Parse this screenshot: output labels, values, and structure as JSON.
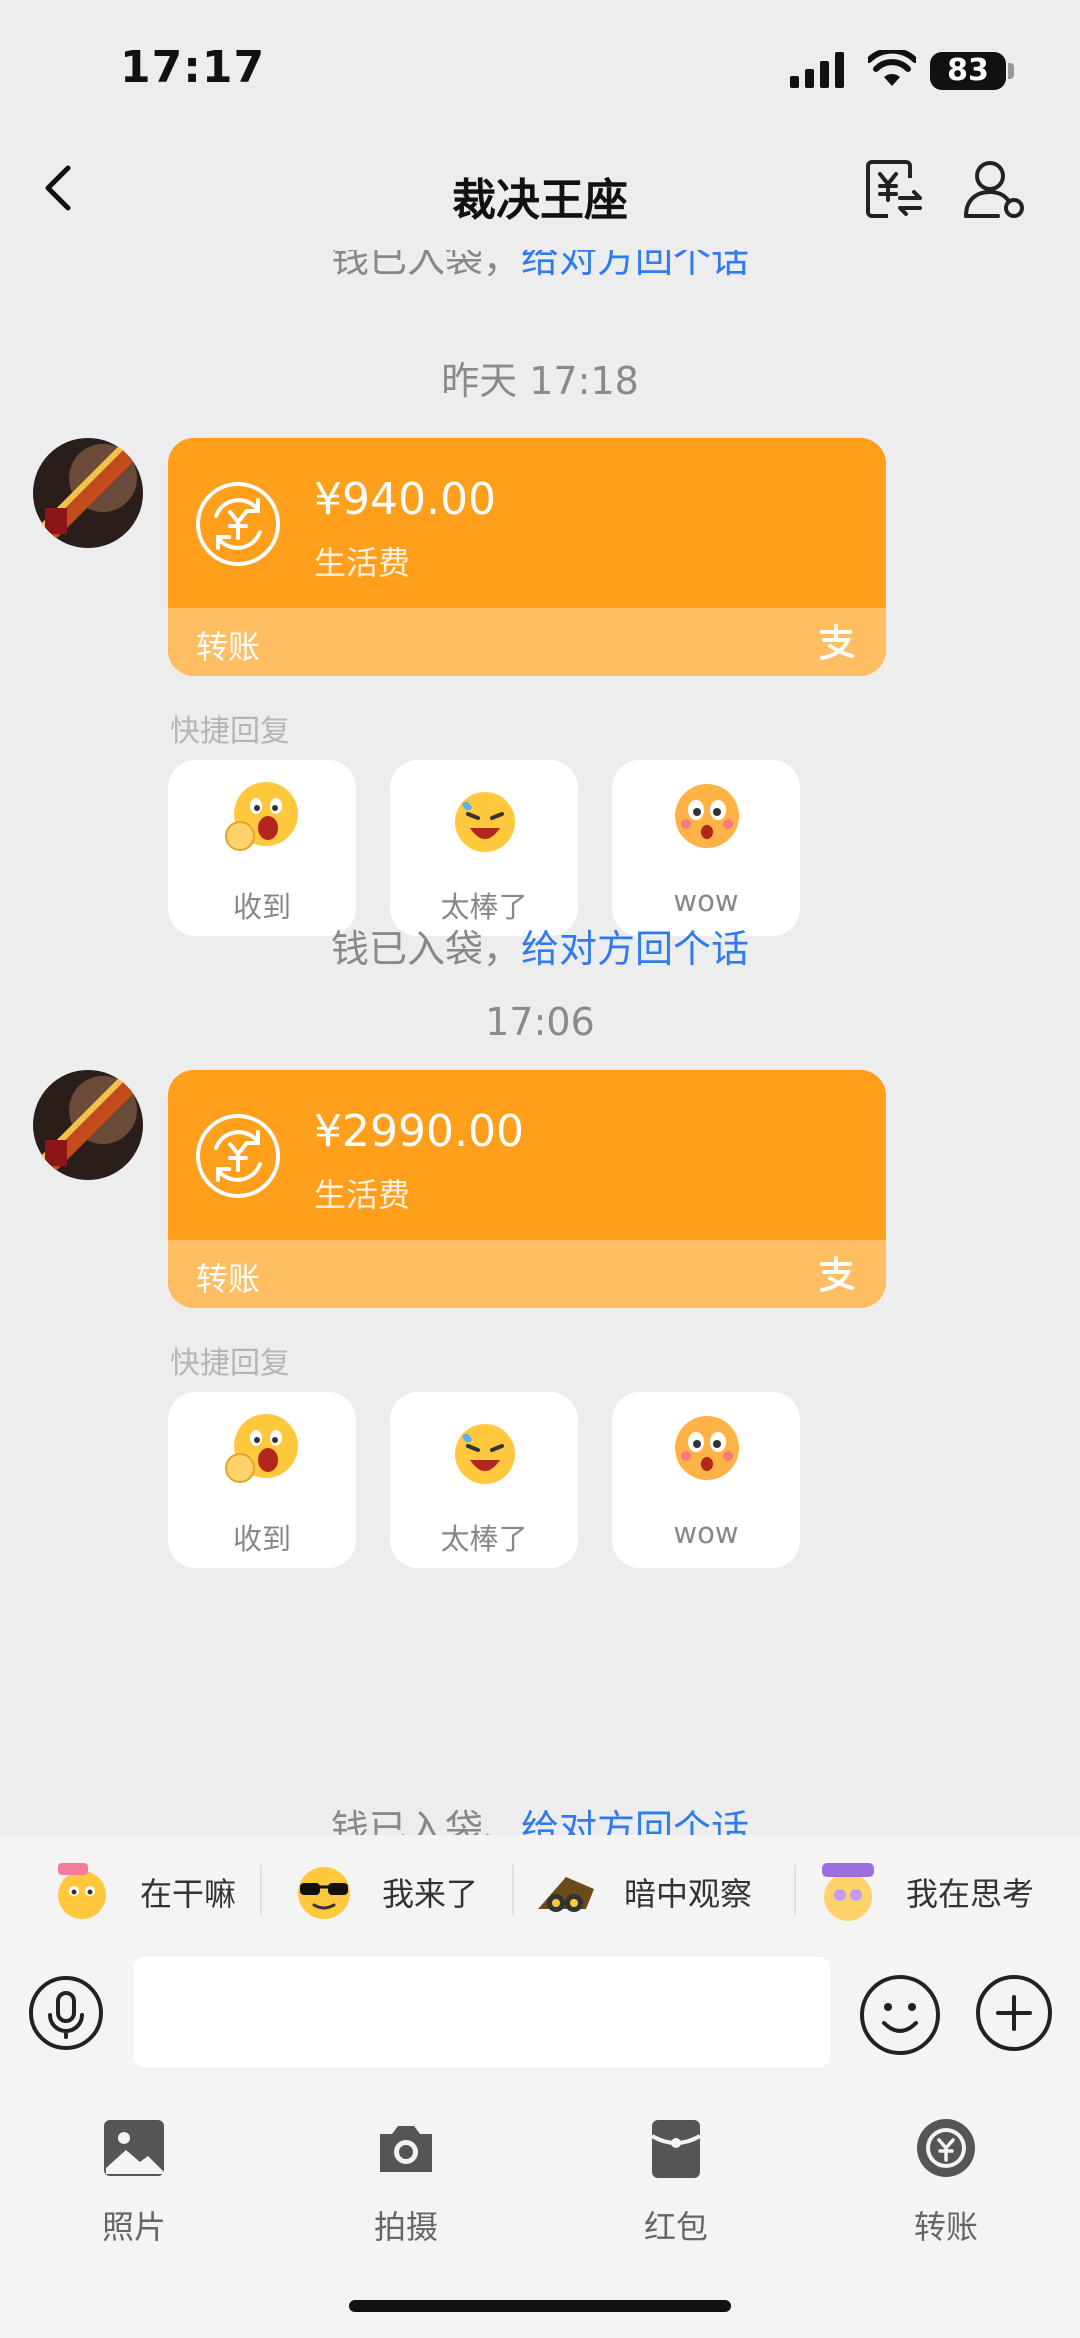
{
  "status_bar": {
    "time": "17:17",
    "battery": "83"
  },
  "header": {
    "title": "裁决王座"
  },
  "chat": {
    "top_notice": {
      "text": "钱已入袋，",
      "link": "给对方回个话"
    },
    "messages": [
      {
        "timestamp": "昨天 17:18",
        "amount": "¥940.00",
        "note": "生活费",
        "label": "转账",
        "quick_reply_title": "快捷回复",
        "quick_replies": [
          "收到",
          "太棒了",
          "wow"
        ],
        "notice": {
          "text": "钱已入袋，",
          "link": "给对方回个话"
        }
      },
      {
        "timestamp": "17:06",
        "amount": "¥2990.00",
        "note": "生活费",
        "label": "转账",
        "quick_reply_title": "快捷回复",
        "quick_replies": [
          "收到",
          "太棒了",
          "wow"
        ],
        "notice": {
          "text": "钱已入袋、",
          "link": "给对方回个话"
        }
      }
    ]
  },
  "sticker_bar": [
    "在干嘛",
    "我来了",
    "暗中观察",
    "我在思考"
  ],
  "input": {
    "placeholder": ""
  },
  "tools": [
    "照片",
    "拍摄",
    "红包",
    "转账"
  ],
  "colors": {
    "card": "#FF9F1C",
    "card_footer": "#FFBE62",
    "link": "#2F7CEE",
    "background": "#EDEDED"
  }
}
